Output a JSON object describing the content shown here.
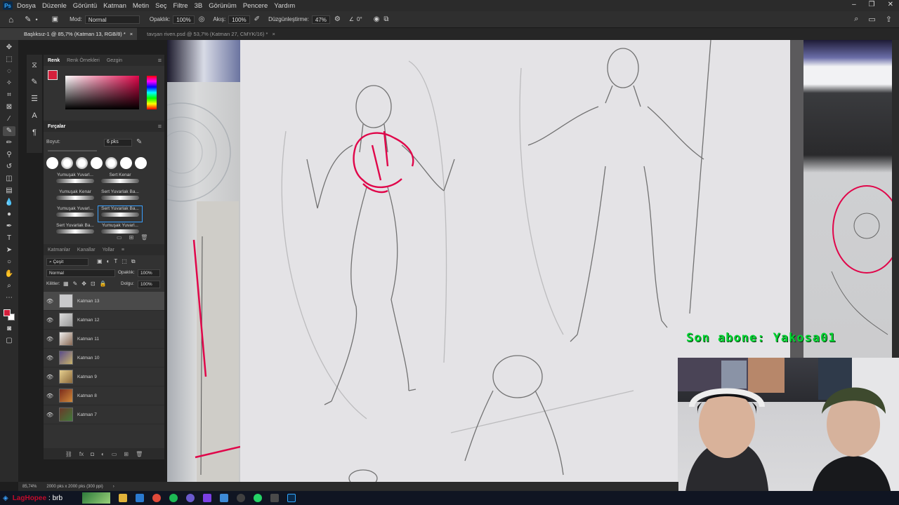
{
  "menubar": {
    "app_icon": "Ps",
    "items": [
      "Dosya",
      "Düzenle",
      "Görüntü",
      "Katman",
      "Metin",
      "Seç",
      "Filtre",
      "3B",
      "Görünüm",
      "Pencere",
      "Yardım"
    ]
  },
  "options": {
    "mode_label": "Mod:",
    "mode_value": "Normal",
    "opacity_label": "Opaklık:",
    "opacity_value": "100%",
    "flow_label": "Akış:",
    "flow_value": "100%",
    "smoothing_label": "Düzgünleştirme:",
    "smoothing_value": "47%",
    "angle_value": "0°"
  },
  "tabs": [
    {
      "label": "Başlıksız-1 @ 85,7% (Katman 13, RGB/8) *",
      "active": true
    },
    {
      "label": "tavşan riven.psd @ 53,7% (Katman 27, CMYK/16) *",
      "active": false
    }
  ],
  "color_panel": {
    "tabs": [
      "Renk",
      "Renk Örnekleri",
      "Gezgin"
    ],
    "fg_color": "#d41f3b",
    "bg_color": "#ffffff"
  },
  "brush_panel": {
    "title": "Fırçalar",
    "size_label": "Boyut:",
    "size_value": "6 pks",
    "brushes": [
      [
        "Yumuşak Yuvarl...",
        "Sert Kenar"
      ],
      [
        "Yumuşak Kenar",
        "Sert Yuvarlak Ba..."
      ],
      [
        "Yumuşak Yuvarl...",
        "Sert Yuvarlak Ba..."
      ],
      [
        "Sert Yuvarlak Ba...",
        "Yumuşak Yuvarl..."
      ]
    ]
  },
  "layers_panel": {
    "tabs": [
      "Katmanlar",
      "Kanallar",
      "Yollar"
    ],
    "filter_label": "Çeşit",
    "blend_mode": "Normal",
    "opacity_label": "Opaklık:",
    "opacity_value": "100%",
    "lock_label": "Kilitler:",
    "fill_label": "Dolgu:",
    "fill_value": "100%",
    "layers": [
      {
        "name": "Katman 13",
        "active": true
      },
      {
        "name": "Katman 12",
        "active": false
      },
      {
        "name": "Katman 11",
        "active": false
      },
      {
        "name": "Katman 10",
        "active": false
      },
      {
        "name": "Katman 9",
        "active": false
      },
      {
        "name": "Katman 8",
        "active": false
      },
      {
        "name": "Katman 7",
        "active": false
      }
    ]
  },
  "status": {
    "zoom": "85,74%",
    "doc_size": "2000 pks x 2000 pks (300 ppi)"
  },
  "overlay": {
    "text": "Son abone: Yakosa01"
  },
  "chat": {
    "username": "LagHopee",
    "message": ": brb"
  }
}
